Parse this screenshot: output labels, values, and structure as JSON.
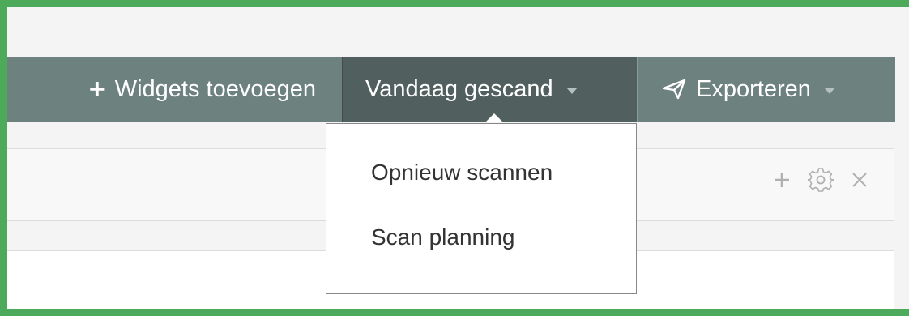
{
  "toolbar": {
    "widgets_button_label": "Widgets toevoegen",
    "scan_dropdown_label": "Vandaag gescand",
    "export_dropdown_label": "Exporteren"
  },
  "scan_menu": {
    "items": [
      {
        "label": "Opnieuw scannen"
      },
      {
        "label": "Scan planning"
      }
    ]
  },
  "widget": {
    "actions": [
      "add-icon",
      "gear-icon",
      "close-icon"
    ]
  },
  "colors": {
    "outer_border": "#4caa5a",
    "toolbar": "#6d817e",
    "toolbar_active": "#51605e",
    "background": "#f4f4f4"
  }
}
